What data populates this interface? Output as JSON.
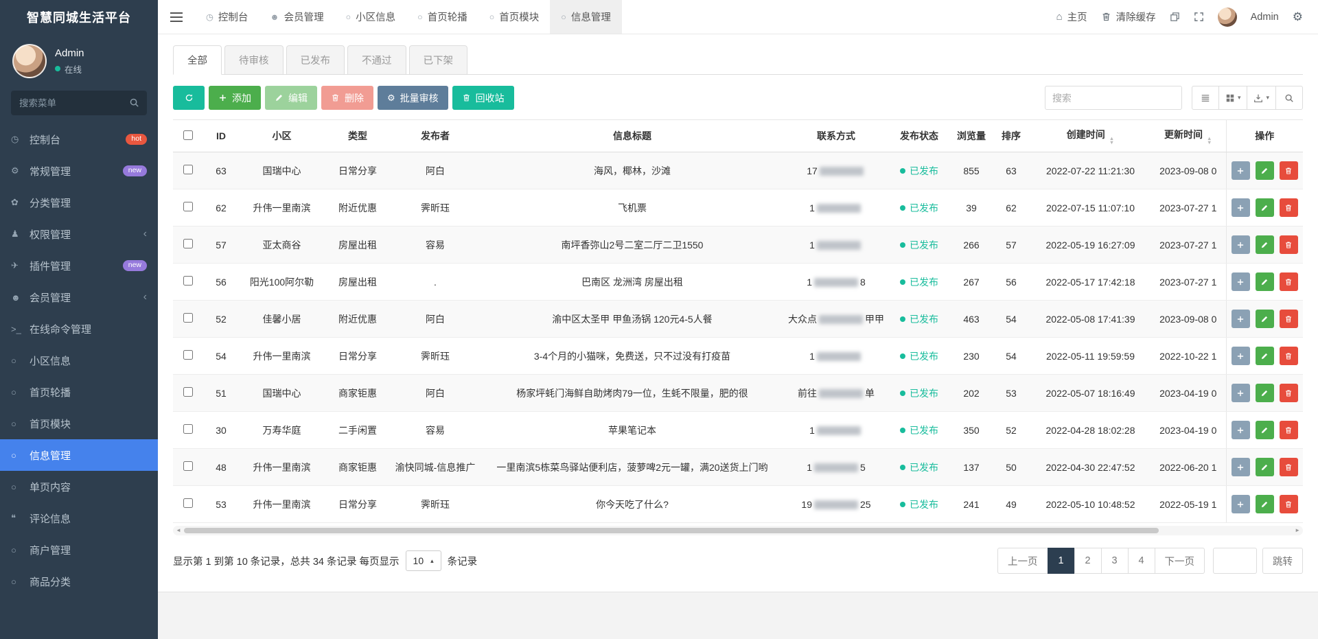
{
  "app": {
    "title": "智慧同城生活平台"
  },
  "theme": {
    "sidebar_bg": "#2e3e4e",
    "menu_active_bg": "#4582ec",
    "teal": "#18bc9c",
    "green": "#4cae4c",
    "red": "#e74c3c",
    "slate_blue": "#5e7d9a",
    "badge_hot": "#e9573f",
    "badge_new": "#967adc",
    "status_published": "#18bc9c",
    "pagination_active": "#2c3e50"
  },
  "icons": {
    "home": "⌂",
    "gear": "⚙",
    "caret_down": "▾",
    "caret_up": "▴",
    "sort_asc": "▲",
    "sort_desc": "▼",
    "scroll_left": "◄",
    "scroll_right": "►"
  },
  "topbar": {
    "tabs": [
      {
        "icon": "◷",
        "label": "控制台"
      },
      {
        "icon": "☻",
        "label": "会员管理"
      },
      {
        "icon": "○",
        "label": "小区信息"
      },
      {
        "icon": "○",
        "label": "首页轮播"
      },
      {
        "icon": "○",
        "label": "首页模块"
      },
      {
        "icon": "○",
        "label": "信息管理",
        "active": true
      }
    ],
    "home": "主页",
    "clear_cache": "清除缓存",
    "username": "Admin"
  },
  "sidebar": {
    "user": {
      "name": "Admin",
      "status": "在线"
    },
    "search_placeholder": "搜索菜单",
    "items": [
      {
        "icon": "◷",
        "label": "控制台",
        "badge": "hot",
        "badge_kind": "hot"
      },
      {
        "icon": "⚙",
        "label": "常规管理",
        "badge": "new",
        "badge_kind": "new"
      },
      {
        "icon": "✿",
        "label": "分类管理"
      },
      {
        "icon": "♟",
        "label": "权限管理",
        "chevron": "‹"
      },
      {
        "icon": "✈",
        "label": "插件管理",
        "badge": "new",
        "badge_kind": "new"
      },
      {
        "icon": "☻",
        "label": "会员管理",
        "chevron": "‹"
      },
      {
        "icon": ">_",
        "label": "在线命令管理"
      },
      {
        "icon": "○",
        "label": "小区信息"
      },
      {
        "icon": "○",
        "label": "首页轮播"
      },
      {
        "icon": "○",
        "label": "首页模块"
      },
      {
        "icon": "○",
        "label": "信息管理",
        "active": true
      },
      {
        "icon": "○",
        "label": "单页内容"
      },
      {
        "icon": "❝",
        "label": "评论信息"
      },
      {
        "icon": "○",
        "label": "商户管理"
      },
      {
        "icon": "○",
        "label": "商品分类"
      }
    ]
  },
  "filter_tabs": [
    {
      "label": "全部",
      "active": true
    },
    {
      "label": "待审核"
    },
    {
      "label": "已发布"
    },
    {
      "label": "不通过"
    },
    {
      "label": "已下架"
    }
  ],
  "toolbar": {
    "add": "添加",
    "edit": "编辑",
    "delete": "删除",
    "batch_audit": "批量审核",
    "recycle": "回收站",
    "search_placeholder": "搜索"
  },
  "table": {
    "headers": {
      "id": "ID",
      "community": "小区",
      "type": "类型",
      "publisher": "发布者",
      "title": "信息标题",
      "contact": "联系方式",
      "status": "发布状态",
      "views": "浏览量",
      "sort": "排序",
      "created": "创建时间",
      "updated": "更新时间",
      "actions": "操作"
    },
    "rows": [
      {
        "id": "63",
        "community": "国瑞中心",
        "type": "日常分享",
        "publisher": "阿白",
        "title": "海风，椰林，沙滩",
        "contact_pre": "17",
        "contact_suf": "",
        "status": "已发布",
        "views": "855",
        "sort": "63",
        "created": "2022-07-22 11:21:30",
        "updated": "2023-09-08 0"
      },
      {
        "id": "62",
        "community": "升伟一里南滨",
        "type": "附近优惠",
        "publisher": "霁昕珏",
        "title": "飞机票",
        "contact_pre": "1",
        "contact_suf": "",
        "status": "已发布",
        "views": "39",
        "sort": "62",
        "created": "2022-07-15 11:07:10",
        "updated": "2023-07-27 1"
      },
      {
        "id": "57",
        "community": "亚太商谷",
        "type": "房屋出租",
        "publisher": "容易",
        "title": "南坪香弥山2号二室二厅二卫1550",
        "contact_pre": "1",
        "contact_suf": "",
        "status": "已发布",
        "views": "266",
        "sort": "57",
        "created": "2022-05-19 16:27:09",
        "updated": "2023-07-27 1"
      },
      {
        "id": "56",
        "community": "阳光100阿尔勒",
        "type": "房屋出租",
        "publisher": ".",
        "title": "巴南区 龙洲湾 房屋出租",
        "contact_pre": "1",
        "contact_suf": "8",
        "status": "已发布",
        "views": "267",
        "sort": "56",
        "created": "2022-05-17 17:42:18",
        "updated": "2023-07-27 1"
      },
      {
        "id": "52",
        "community": "佳馨小居",
        "type": "附近优惠",
        "publisher": "阿白",
        "title": "渝中区太圣甲 甲鱼汤锅 120元4-5人餐",
        "contact_pre": "大众点",
        "contact_suf": "甲甲",
        "status": "已发布",
        "views": "463",
        "sort": "54",
        "created": "2022-05-08 17:41:39",
        "updated": "2023-09-08 0"
      },
      {
        "id": "54",
        "community": "升伟一里南滨",
        "type": "日常分享",
        "publisher": "霁昕珏",
        "title": "3-4个月的小猫咪，免费送，只不过没有打疫苗",
        "contact_pre": "1",
        "contact_suf": "",
        "status": "已发布",
        "views": "230",
        "sort": "54",
        "created": "2022-05-11 19:59:59",
        "updated": "2022-10-22 1"
      },
      {
        "id": "51",
        "community": "国瑞中心",
        "type": "商家钜惠",
        "publisher": "阿白",
        "title": "杨家坪蚝门海鲜自助烤肉79一位，生蚝不限量，肥的很",
        "contact_pre": "前往",
        "contact_suf": "单",
        "status": "已发布",
        "views": "202",
        "sort": "53",
        "created": "2022-05-07 18:16:49",
        "updated": "2023-04-19 0"
      },
      {
        "id": "30",
        "community": "万寿华庭",
        "type": "二手闲置",
        "publisher": "容易",
        "title": "苹果笔记本",
        "contact_pre": "1",
        "contact_suf": "",
        "status": "已发布",
        "views": "350",
        "sort": "52",
        "created": "2022-04-28 18:02:28",
        "updated": "2023-04-19 0"
      },
      {
        "id": "48",
        "community": "升伟一里南滨",
        "type": "商家钜惠",
        "publisher": "渝快同城-信息推广",
        "title": "一里南滨5栋菜鸟驿站便利店，菠萝啤2元一罐，满20送货上门哟",
        "contact_pre": "1",
        "contact_suf": "5",
        "status": "已发布",
        "views": "137",
        "sort": "50",
        "created": "2022-04-30 22:47:52",
        "updated": "2022-06-20 1"
      },
      {
        "id": "53",
        "community": "升伟一里南滨",
        "type": "日常分享",
        "publisher": "霁昕珏",
        "title": "你今天吃了什么?",
        "contact_pre": "19",
        "contact_suf": "25",
        "status": "已发布",
        "views": "241",
        "sort": "49",
        "created": "2022-05-10 10:48:52",
        "updated": "2022-05-19 1"
      }
    ]
  },
  "footer": {
    "summary_pre": "显示第 1 到第 10 条记录，总共 34 条记录 每页显示",
    "page_size": "10",
    "summary_post": "条记录",
    "pagination": {
      "prev": "上一页",
      "pages": [
        {
          "n": "1",
          "active": true
        },
        {
          "n": "2"
        },
        {
          "n": "3"
        },
        {
          "n": "4"
        }
      ],
      "next": "下一页",
      "jump": "跳转"
    }
  }
}
